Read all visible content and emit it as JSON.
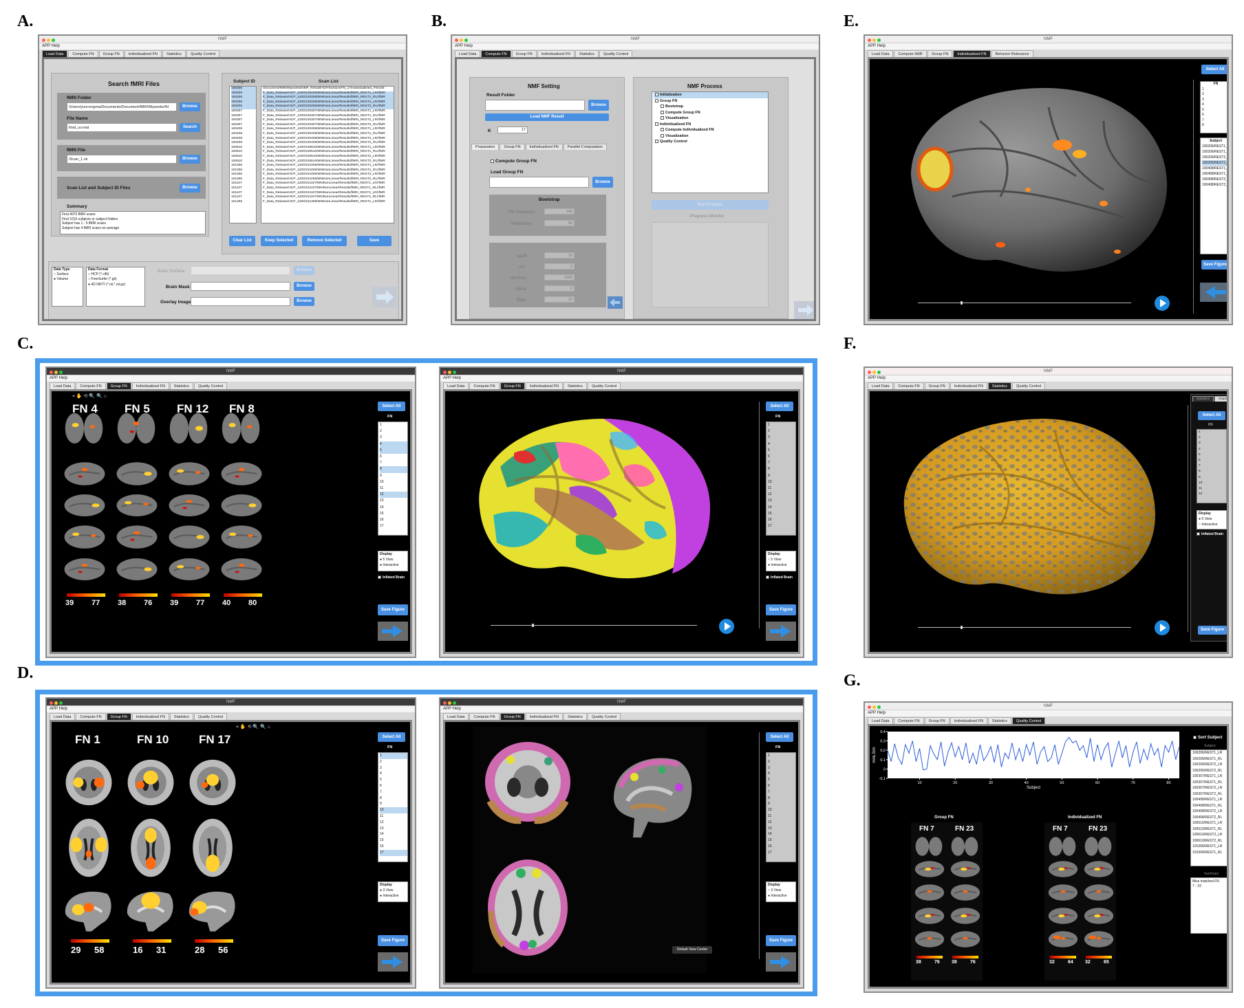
{
  "panel_labels": {
    "a": "A.",
    "b": "B.",
    "c": "C.",
    "d": "D.",
    "e": "E.",
    "f": "F.",
    "g": "G."
  },
  "window": {
    "title": "NMF",
    "menu": "APP  Help"
  },
  "tabs_a": [
    "Load Data",
    "Compute FN",
    "Group FN",
    "Individualized FN",
    "Statistics",
    "Quality Control"
  ],
  "tabs_e": [
    "Load Data",
    "Compute NMF",
    "Group FN",
    "Individualized FN",
    "Behavior Relevance"
  ],
  "panelA": {
    "search_title": "Search fMRI Files",
    "fmri_folder_label": "fMRI Folder",
    "fmri_folder_value": "/Users/yuncongma/Documents/Document/fMRI/Myworks/NI",
    "file_name_label": "File Name",
    "file_name_value": "final_uv.mat",
    "fmri_file_label": "fMRI File",
    "fmri_file_value": "/Scan_1.nii",
    "scanlist_label": "Scan List and Subject ID Files",
    "summary_label": "Summary",
    "summary_lines": [
      "Find 4070 fMRI scans",
      "Find 1016 subjects or subject folders",
      "Subject has 1 - 5 fMRI scans",
      "Subject has 4 fMRI scans on average"
    ],
    "browse": "Browse",
    "search": "Search",
    "subject_id_label": "Subject ID",
    "scan_list_label": "Scan List",
    "subject_ids": [
      "100206",
      "100206",
      "100206",
      "100206",
      "100206",
      "100307",
      "100307",
      "100307",
      "100307",
      "100408",
      "100408",
      "100408",
      "100408",
      "100610",
      "100610",
      "100610",
      "100610",
      "101006",
      "101006",
      "101006",
      "101006",
      "101107",
      "101107",
      "101107",
      "101107",
      "101309"
    ],
    "scan_rows": [
      "/Document/fMRI/Myworks/NMF_Result/HCP/Surface/FN_17/individualized_FN/100",
      "F_Data_Release/HCP_1200/100206/MNINonLinear/Results/fMRI_REST1_LR/rfMR",
      "F_Data_Release/HCP_1200/100206/MNINonLinear/Results/fMRI_REST1_RL/rfMR",
      "F_Data_Release/HCP_1200/100206/MNINonLinear/Results/fMRI_REST2_LR/rfMR",
      "F_Data_Release/HCP_1200/100206/MNINonLinear/Results/fMRI_REST2_RL/rfMR",
      "F_Data_Release/HCP_1200/100307/MNINonLinear/Results/fMRI_REST1_LR/rfMR",
      "F_Data_Release/HCP_1200/100307/MNINonLinear/Results/fMRI_REST1_RL/rfMR",
      "F_Data_Release/HCP_1200/100307/MNINonLinear/Results/fMRI_REST2_LR/rfMR",
      "F_Data_Release/HCP_1200/100307/MNINonLinear/Results/fMRI_REST2_RL/rfMR",
      "F_Data_Release/HCP_1200/100408/MNINonLinear/Results/fMRI_REST1_LR/rfMR",
      "F_Data_Release/HCP_1200/100408/MNINonLinear/Results/fMRI_REST1_RL/rfMR",
      "F_Data_Release/HCP_1200/100408/MNINonLinear/Results/fMRI_REST2_LR/rfMR",
      "F_Data_Release/HCP_1200/100408/MNINonLinear/Results/fMRI_REST2_RL/rfMR",
      "F_Data_Release/HCP_1200/100610/MNINonLinear/Results/fMRI_REST1_LR/rfMR",
      "F_Data_Release/HCP_1200/100610/MNINonLinear/Results/fMRI_REST1_RL/rfMR",
      "F_Data_Release/HCP_1200/100610/MNINonLinear/Results/fMRI_REST2_LR/rfMR",
      "F_Data_Release/HCP_1200/100610/MNINonLinear/Results/fMRI_REST2_RL/rfMR",
      "F_Data_Release/HCP_1200/101006/MNINonLinear/Results/fMRI_REST1_LR/rfMR",
      "F_Data_Release/HCP_1200/101006/MNINonLinear/Results/fMRI_REST1_RL/rfMR",
      "F_Data_Release/HCP_1200/101006/MNINonLinear/Results/fMRI_REST2_LR/rfMR",
      "F_Data_Release/HCP_1200/101006/MNINonLinear/Results/fMRI_REST2_RL/rfMR",
      "F_Data_Release/HCP_1200/101107/MNINonLinear/Results/fMRI_REST1_LR/rfMR",
      "F_Data_Release/HCP_1200/101107/MNINonLinear/Results/fMRI_REST1_RL/rfMR",
      "F_Data_Release/HCP_1200/101107/MNINonLinear/Results/fMRI_REST2_LR/rfMR",
      "F_Data_Release/HCP_1200/101107/MNINonLinear/Results/fMRI_REST2_RL/rfMR",
      "F_Data_Release/HCP_1200/101309/MNINonLinear/Results/fMRI_REST1_LR/rfMR"
    ],
    "clear_list": "Clear List",
    "keep_selected": "Keep Selected",
    "remove_selected": "Remove Selected",
    "save": "Save",
    "data_type_label": "Data Type",
    "data_type_options": [
      "Surface",
      "Volume"
    ],
    "data_format_label": "Data Format",
    "data_format_options": [
      "HCP (*.cifti)",
      "FreeSurfer (*.gii)",
      "4D NIFTI (*.nii,*.nii.gz)"
    ],
    "brain_surface": "Brain Surface",
    "brain_mask": "Brain Mask",
    "overlay_image": "Overlay Image"
  },
  "panelB": {
    "nmf_setting": "NMF Setting",
    "result_folder": "Result Folder",
    "load_nmf": "Load NMF Result",
    "k_label": "K",
    "k_value": "17",
    "subtabs": [
      "Preparation",
      "Group FN",
      "Individualized FN",
      "Parallel Computation"
    ],
    "compute_group_fn": "Compute Group FN",
    "load_group_fn": "Load Group FN",
    "bootstrap": "Bootstrap",
    "file_selection": "File Selection",
    "file_selection_value": "100",
    "repetition": "Repetition",
    "repetition_value": "50",
    "params": [
      {
        "k": "spaR",
        "v": "10"
      },
      {
        "k": "vxl",
        "v": "2"
      },
      {
        "k": "iterNum",
        "v": "1000"
      },
      {
        "k": "Alpha",
        "v": "2"
      },
      {
        "k": "Beta",
        "v": "10"
      }
    ],
    "nmf_process": "NMF Process",
    "process_items": [
      "Initialization",
      "Group FN",
      "Bootstrap",
      "Compute Group FN",
      "Visualization",
      "Individualized FN",
      "Compute Individualized FN",
      "Visualization",
      "Quality Control"
    ],
    "run_process": "Run Process",
    "progress_monitor": "Progress Monitor"
  },
  "common": {
    "select_all": "Select All",
    "fn": "FN",
    "display": "Display",
    "view5": "5 View",
    "interactive": "Interactive",
    "inflated": "Inflated Brain",
    "save_figure": "Save Figure",
    "view3": "3 View",
    "subject": "Subject",
    "default_view": "Default View Center"
  },
  "fn_list17": [
    "1",
    "2",
    "3",
    "4",
    "5",
    "6",
    "7",
    "8",
    "9",
    "10",
    "11",
    "12",
    "13",
    "14",
    "15",
    "16",
    "17"
  ],
  "fn_list8": [
    "1",
    "2",
    "3",
    "4",
    "5",
    "6",
    "7",
    "8"
  ],
  "fn_list12": [
    "1",
    "2",
    "3",
    "4",
    "5",
    "6",
    "7",
    "8",
    "9",
    "10",
    "11",
    "12"
  ],
  "subjects_e": [
    "100206/REST1_L",
    "100206/REST1_R",
    "100206/REST2_L",
    "100206/REST2_",
    "100408/REST1_",
    "100408/REST1_",
    "100408/REST2_",
    "100408/REST2_"
  ],
  "panelC": {
    "headers": [
      "FN 4",
      "FN 5",
      "FN 12",
      "FN 8"
    ],
    "ranges": [
      [
        "39",
        "77"
      ],
      [
        "38",
        "76"
      ],
      [
        "39",
        "77"
      ],
      [
        "40",
        "80"
      ]
    ]
  },
  "panelD": {
    "headers": [
      "FN 1",
      "FN 10",
      "FN 17"
    ],
    "ranges": [
      [
        "29",
        "58"
      ],
      [
        "16",
        "31"
      ],
      [
        "28",
        "56"
      ]
    ]
  },
  "panelF": {
    "subtabs": [
      "Statistics",
      "Display"
    ]
  },
  "panelG": {
    "sort_subject": "Sort Subject",
    "subject": "Subject",
    "summary": "Summary",
    "summary_text": "Miss matched FN\n7 - 23",
    "group_fn": "Group FN",
    "individualized_fn": "Individualized FN",
    "headers_group": [
      "FN 7",
      "FN 23"
    ],
    "headers_ind": [
      "FN 7",
      "FN 23"
    ],
    "ranges_group": [
      [
        "38",
        "76"
      ],
      [
        "38",
        "76"
      ]
    ],
    "ranges_ind": [
      [
        "32",
        "64"
      ],
      [
        "32",
        "65"
      ]
    ],
    "subjects": [
      "100206/REST1_LR",
      "100206/REST1_RL",
      "100206/REST2_LR",
      "100206/REST2_RL",
      "100307/REST1_LR",
      "100307/REST1_RL",
      "100307/REST2_LR",
      "100307/REST2_RL",
      "100408/REST1_LR",
      "100408/REST1_RL",
      "100408/REST2_LR",
      "100408/REST2_RL",
      "100610/REST1_LR",
      "100610/REST1_RL",
      "100610/REST2_LR",
      "100610/REST2_RL",
      "101006/REST1_LR",
      "101006/REST1_RL"
    ]
  },
  "chart_data": {
    "type": "line",
    "xlabel": "Subject",
    "ylabel": "minLSim",
    "xlim": [
      1,
      83
    ],
    "ylim": [
      -0.1,
      0.4
    ],
    "xticks": [
      "10",
      "20",
      "30",
      "40",
      "50",
      "60",
      "70",
      "80"
    ],
    "yticks": [
      "-0.1",
      "0",
      "0.1",
      "0.2",
      "0.3",
      "0.4"
    ],
    "y": [
      0.2,
      0.08,
      0.27,
      0.12,
      0.05,
      0.26,
      0.17,
      0.3,
      0.08,
      0.22,
      -0.01,
      0.0,
      0.25,
      0.16,
      0.1,
      0.29,
      0.03,
      0.18,
      0.28,
      0.13,
      0.24,
      0.1,
      0.28,
      0.06,
      0.17,
      0.05,
      0.26,
      0.09,
      0.15,
      0.24,
      0.07,
      0.26,
      0.02,
      0.17,
      0.11,
      0.28,
      0.1,
      0.22,
      0.08,
      0.26,
      0.15,
      0.29,
      0.05,
      0.18,
      0.24,
      0.08,
      0.12,
      0.26,
      0.05,
      0.17,
      0.29,
      0.34,
      0.28,
      0.3,
      0.2,
      0.25,
      0.12,
      0.33,
      0.08,
      0.26,
      0.1,
      0.22,
      0.28,
      0.02,
      0.16,
      0.3,
      0.12,
      0.25,
      0.02,
      0.18,
      0.29,
      0.06,
      0.21,
      0.1,
      0.27,
      0.15,
      0.22,
      0.02,
      0.25,
      0.18,
      0.3,
      0.1,
      0.24
    ],
    "color": "#2a5bd7"
  }
}
